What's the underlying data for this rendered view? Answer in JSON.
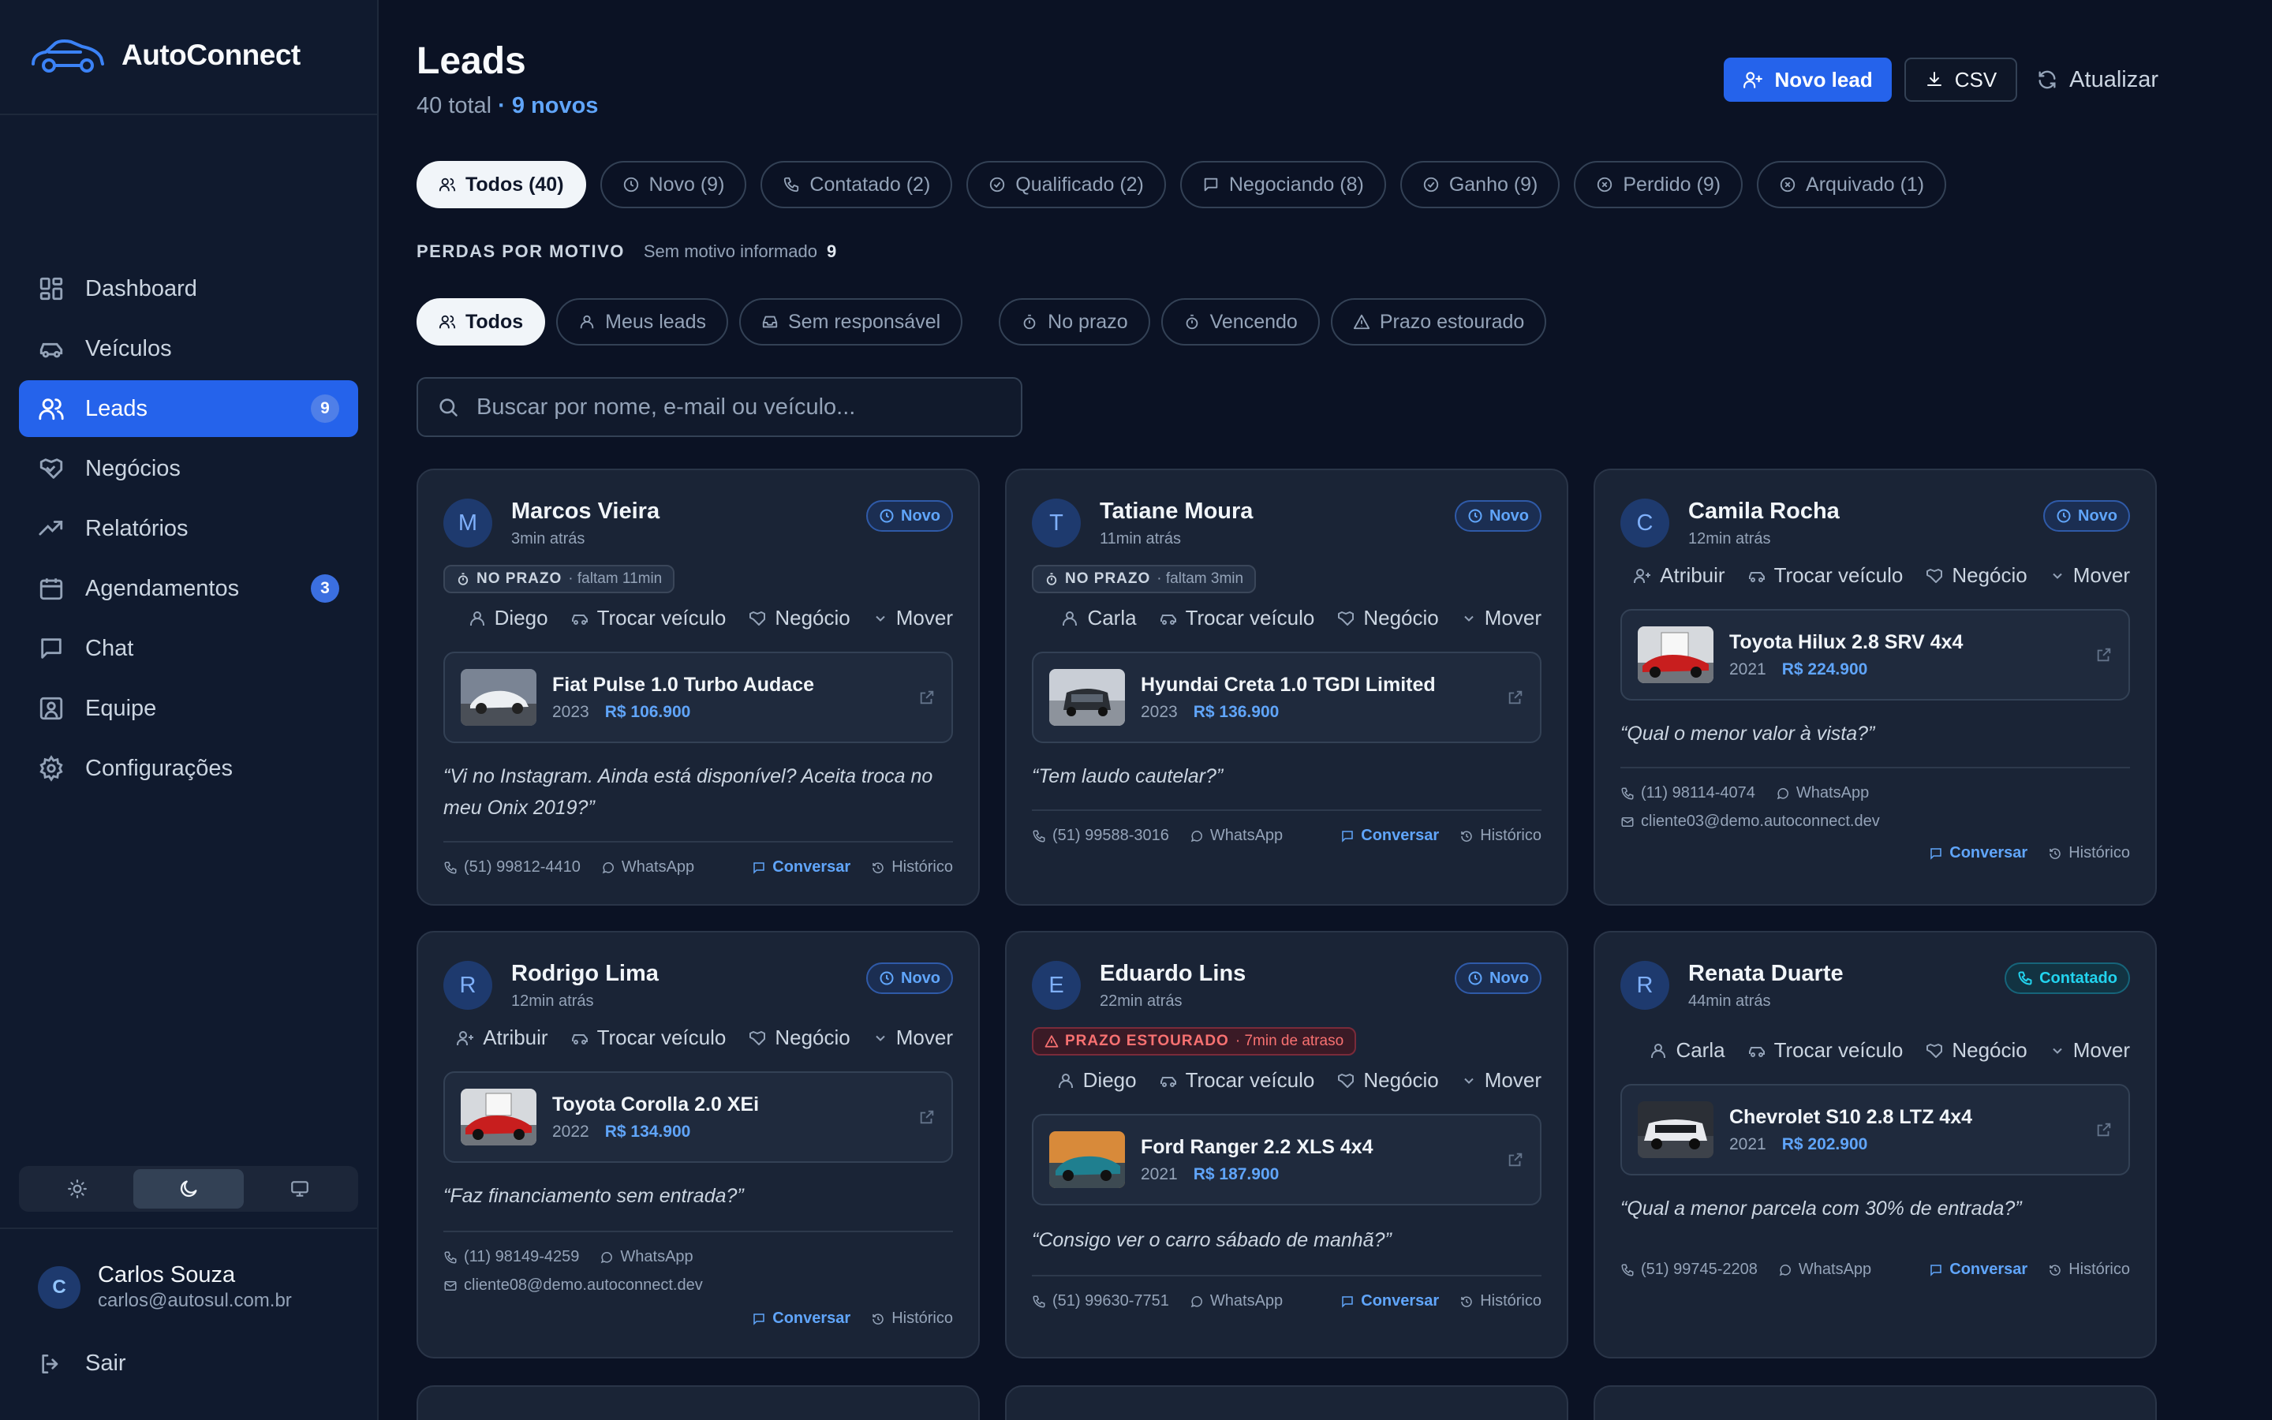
{
  "app": {
    "name": "AutoConnect",
    "accent": "#2563eb"
  },
  "sidebar": {
    "items": [
      {
        "label": "Dashboard",
        "icon": "grid-icon"
      },
      {
        "label": "Veículos",
        "icon": "car-icon"
      },
      {
        "label": "Leads",
        "icon": "users-icon",
        "badge": "9",
        "active": true
      },
      {
        "label": "Negócios",
        "icon": "handshake-icon"
      },
      {
        "label": "Relatórios",
        "icon": "trending-up-icon"
      },
      {
        "label": "Agendamentos",
        "icon": "calendar-icon",
        "badge": "3"
      },
      {
        "label": "Chat",
        "icon": "message-icon"
      },
      {
        "label": "Equipe",
        "icon": "user-square-icon"
      },
      {
        "label": "Configurações",
        "icon": "gear-icon"
      }
    ],
    "theme_options": [
      "light",
      "dark",
      "system"
    ],
    "theme_selected": "dark",
    "user": {
      "initial": "C",
      "name": "Carlos Souza",
      "email": "carlos@autosul.com.br"
    },
    "logout_label": "Sair"
  },
  "header": {
    "title": "Leads",
    "total": "40 total",
    "new_count": "· 9 novos",
    "new_lead_label": "Novo lead",
    "csv_label": "CSV",
    "refresh_label": "Atualizar"
  },
  "status_tabs": [
    {
      "label": "Todos (40)",
      "icon": "users-icon",
      "active": true
    },
    {
      "label": "Novo (9)",
      "icon": "clock-icon"
    },
    {
      "label": "Contatado (2)",
      "icon": "phone-icon"
    },
    {
      "label": "Qualificado (2)",
      "icon": "check-circle-icon"
    },
    {
      "label": "Negociando (8)",
      "icon": "message-icon"
    },
    {
      "label": "Ganho (9)",
      "icon": "check-circle-icon"
    },
    {
      "label": "Perdido (9)",
      "icon": "x-circle-icon"
    },
    {
      "label": "Arquivado (1)",
      "icon": "x-circle-icon"
    }
  ],
  "losses": {
    "label": "PERDAS POR MOTIVO",
    "reason": "Sem motivo informado",
    "count": "9"
  },
  "owner_filters": [
    {
      "label": "Todos",
      "icon": "users-icon",
      "active": true
    },
    {
      "label": "Meus leads",
      "icon": "user-icon"
    },
    {
      "label": "Sem responsável",
      "icon": "inbox-icon"
    }
  ],
  "deadline_filters": [
    {
      "label": "No prazo",
      "icon": "timer-icon"
    },
    {
      "label": "Vencendo",
      "icon": "timer-icon"
    },
    {
      "label": "Prazo estourado",
      "icon": "alert-triangle-icon"
    }
  ],
  "search": {
    "placeholder": "Buscar por nome, e-mail ou veículo..."
  },
  "card_labels": {
    "assign": "Atribuir",
    "swap_vehicle": "Trocar veículo",
    "deal": "Negócio",
    "move": "Mover",
    "whatsapp": "WhatsApp",
    "chat": "Conversar",
    "history": "Histórico"
  },
  "leads": [
    {
      "initial": "M",
      "name": "Marcos Vieira",
      "time": "3min atrás",
      "status": "Novo",
      "deadline_label": "NO PRAZO",
      "deadline_detail": "· faltam 11min",
      "owner": "Diego",
      "car": "Fiat Pulse 1.0 Turbo Audace",
      "year": "2023",
      "price": "R$ 106.900",
      "quote": "“Vi no Instagram. Ainda está disponível? Aceita troca no meu Onix 2019?”",
      "phone": "(51) 99812-4410"
    },
    {
      "initial": "T",
      "name": "Tatiane Moura",
      "time": "11min atrás",
      "status": "Novo",
      "deadline_label": "NO PRAZO",
      "deadline_detail": "· faltam 3min",
      "owner": "Carla",
      "car": "Hyundai Creta 1.0 TGDI Limited",
      "year": "2023",
      "price": "R$ 136.900",
      "quote": "“Tem laudo cautelar?”",
      "phone": "(51) 99588-3016"
    },
    {
      "initial": "C",
      "name": "Camila Rocha",
      "time": "12min atrás",
      "status": "Novo",
      "owner": "Atribuir",
      "car": "Toyota Hilux 2.8 SRV 4x4",
      "year": "2021",
      "price": "R$ 224.900",
      "quote": "“Qual o menor valor à vista?”",
      "phone": "(11) 98114-4074",
      "email": "cliente03@demo.autoconnect.dev"
    },
    {
      "initial": "R",
      "name": "Rodrigo Lima",
      "time": "12min atrás",
      "status": "Novo",
      "owner": "Atribuir",
      "car": "Toyota Corolla 2.0 XEi",
      "year": "2022",
      "price": "R$ 134.900",
      "quote": "“Faz financiamento sem entrada?”",
      "phone": "(11) 98149-4259",
      "email": "cliente08@demo.autoconnect.dev"
    },
    {
      "initial": "E",
      "name": "Eduardo Lins",
      "time": "22min atrás",
      "status": "Novo",
      "deadline_label": "PRAZO ESTOURADO",
      "deadline_detail": "· 7min de atraso",
      "owner": "Diego",
      "car": "Ford Ranger 2.2 XLS 4x4",
      "year": "2021",
      "price": "R$ 187.900",
      "quote": "“Consigo ver o carro sábado de manhã?”",
      "phone": "(51) 99630-7751"
    },
    {
      "initial": "R",
      "name": "Renata Duarte",
      "time": "44min atrás",
      "status": "Contatado",
      "owner": "Carla",
      "car": "Chevrolet S10 2.8 LTZ 4x4",
      "year": "2021",
      "price": "R$ 202.900",
      "quote": "“Qual a menor parcela com 30% de entrada?”",
      "phone": "(51) 99745-2208"
    }
  ]
}
